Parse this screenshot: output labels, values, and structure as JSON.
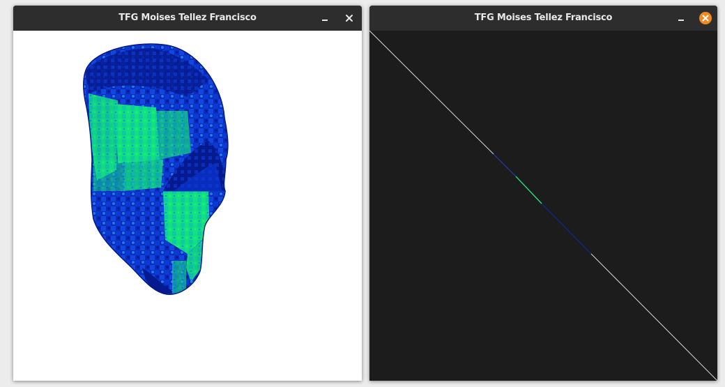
{
  "windows": [
    {
      "title": "TFG Moises Tellez Francisco",
      "controls": {
        "minimize_icon": "minimize-icon",
        "close_icon": "close-icon"
      },
      "canvas": {
        "background": "#ffffff",
        "content": "textured 3D head mesh, blue and green"
      }
    },
    {
      "title": "TFG Moises Tellez Francisco",
      "controls": {
        "minimize_icon": "minimize-icon",
        "close_icon": "close-icon",
        "close_state": "active"
      },
      "canvas": {
        "background": "#1c1c1c",
        "content": "diagonal line render"
      }
    }
  ],
  "colors": {
    "titlebar": "#2d2d2d",
    "title_text": "#e8e8e8",
    "close_active": "#f08a24",
    "mesh_blue": "#0a2fc8",
    "mesh_green": "#10e880",
    "mesh_dark": "#071680"
  }
}
